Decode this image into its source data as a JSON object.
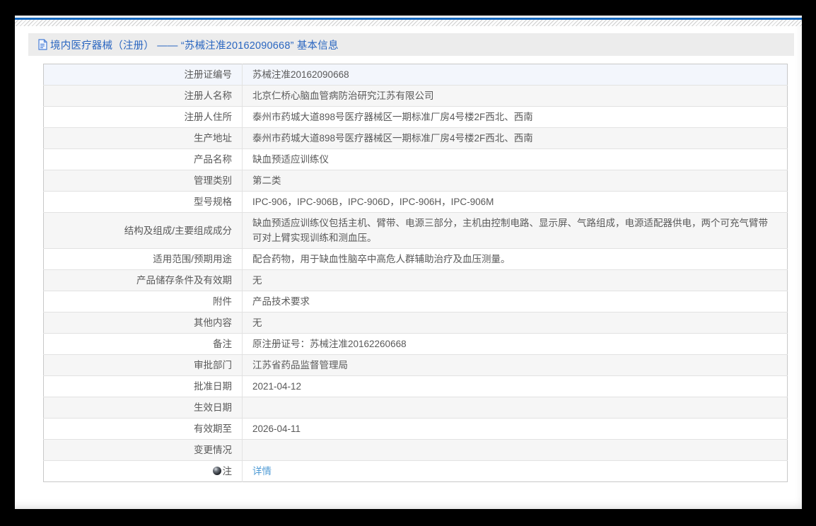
{
  "colors": {
    "top_rule_blue": "#1568bf",
    "title_blue": "#2a66c0",
    "link_blue": "#4f9bd5",
    "header_bar_bg": "#ececec",
    "row_stripe": "#f6f6f6",
    "row_highlight": "#f3f6fc"
  },
  "header": {
    "icon": "document-icon",
    "title": "境内医疗器械（注册） —— “苏械注准20162090668” 基本信息"
  },
  "table": {
    "rows": [
      {
        "label": "注册证编号",
        "value": "苏械注准20162090668",
        "highlight": true
      },
      {
        "label": "注册人名称",
        "value": "北京仁桥心脑血管病防治研究江苏有限公司"
      },
      {
        "label": "注册人住所",
        "value": "泰州市药城大道898号医疗器械区一期标准厂房4号楼2F西北、西南"
      },
      {
        "label": "生产地址",
        "value": "泰州市药城大道898号医疗器械区一期标准厂房4号楼2F西北、西南"
      },
      {
        "label": "产品名称",
        "value": "缺血预适应训练仪"
      },
      {
        "label": "管理类别",
        "value": "第二类"
      },
      {
        "label": "型号规格",
        "value": "IPC-906，IPC-906B，IPC-906D，IPC-906H，IPC-906M"
      },
      {
        "label": "结构及组成/主要组成成分",
        "value": "缺血预适应训练仪包括主机、臂带、电源三部分，主机由控制电路、显示屏、气路组成，电源适配器供电，两个可充气臂带可对上臂实现训练和测血压。"
      },
      {
        "label": "适用范围/预期用途",
        "value": "配合药物，用于缺血性脑卒中高危人群辅助治疗及血压测量。"
      },
      {
        "label": "产品储存条件及有效期",
        "value": "无"
      },
      {
        "label": "附件",
        "value": "产品技术要求"
      },
      {
        "label": "其他内容",
        "value": "无"
      },
      {
        "label": "备注",
        "value": "原注册证号：苏械注准20162260668"
      },
      {
        "label": "审批部门",
        "value": "江苏省药品监督管理局"
      },
      {
        "label": "批准日期",
        "value": "2021-04-12"
      },
      {
        "label": "生效日期",
        "value": ""
      },
      {
        "label": "有效期至",
        "value": "2026-04-11"
      },
      {
        "label": "变更情况",
        "value": ""
      },
      {
        "label": "注",
        "label_icon": "note-icon",
        "value": "详情",
        "link": true
      }
    ]
  }
}
